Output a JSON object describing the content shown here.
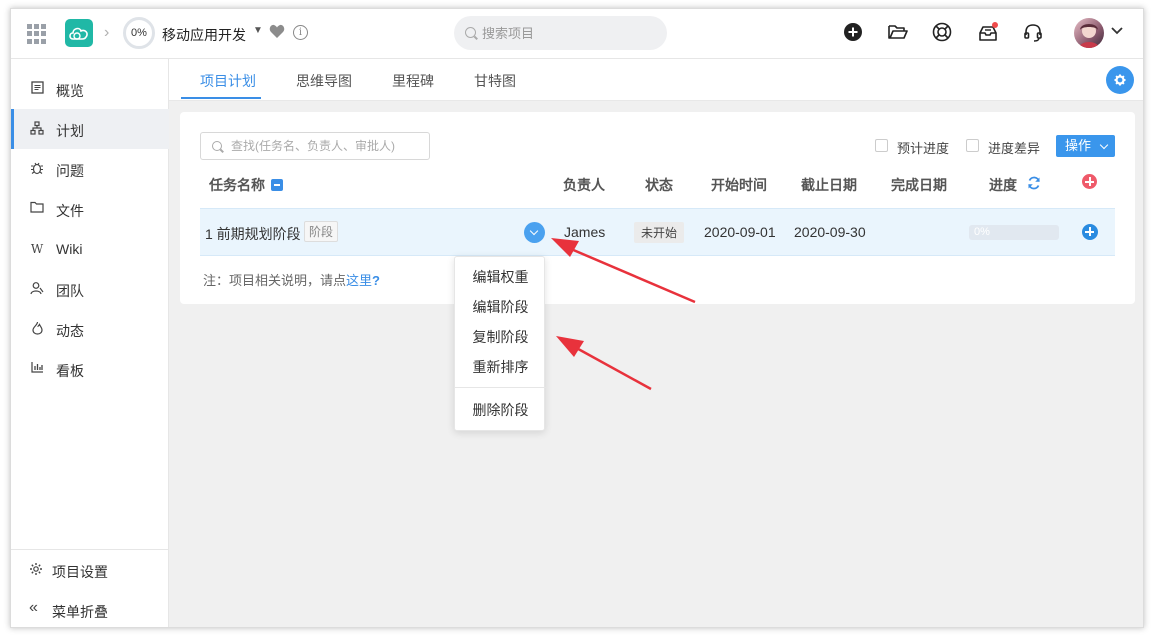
{
  "header": {
    "progress": "0%",
    "project_name": "移动应用开发",
    "search_placeholder": "搜索项目"
  },
  "sidebar": {
    "items": [
      {
        "label": "概览",
        "icon": "overview-icon"
      },
      {
        "label": "计划",
        "icon": "plan-icon",
        "active": true
      },
      {
        "label": "问题",
        "icon": "bug-icon"
      },
      {
        "label": "文件",
        "icon": "folder-icon"
      },
      {
        "label": "Wiki",
        "icon": "wiki-icon"
      },
      {
        "label": "团队",
        "icon": "team-icon"
      },
      {
        "label": "动态",
        "icon": "activity-icon"
      },
      {
        "label": "看板",
        "icon": "chart-icon"
      }
    ],
    "settings_label": "项目设置",
    "collapse_label": "菜单折叠"
  },
  "tabs": [
    {
      "label": "项目计划",
      "active": true
    },
    {
      "label": "思维导图"
    },
    {
      "label": "里程碑"
    },
    {
      "label": "甘特图"
    }
  ],
  "toolbar": {
    "filter_placeholder": "查找(任务名、负责人、审批人)",
    "planned_progress_label": "预计进度",
    "progress_diff_label": "进度差异",
    "operate_label": "操作"
  },
  "table": {
    "headers": {
      "name": "任务名称",
      "owner": "负责人",
      "status": "状态",
      "start": "开始时间",
      "deadline": "截止日期",
      "complete": "完成日期",
      "progress": "进度"
    },
    "rows": [
      {
        "name": "1 前期规划阶段",
        "tag": "阶段",
        "owner": "James",
        "status": "未开始",
        "start": "2020-09-01",
        "deadline": "2020-09-30",
        "complete": "",
        "progress": "0%",
        "progress_value": 0
      }
    ],
    "note_prefix": "注：项目相关说明，请点",
    "note_link": "这里",
    "note_suffix": "?"
  },
  "menu": {
    "items": [
      "编辑权重",
      "编辑阶段",
      "复制阶段",
      "重新排序"
    ],
    "delete_label": "删除阶段"
  },
  "colors": {
    "accent": "#3a8ee6",
    "logo": "#20b8a6",
    "annotation_arrow": "#e8323c"
  }
}
